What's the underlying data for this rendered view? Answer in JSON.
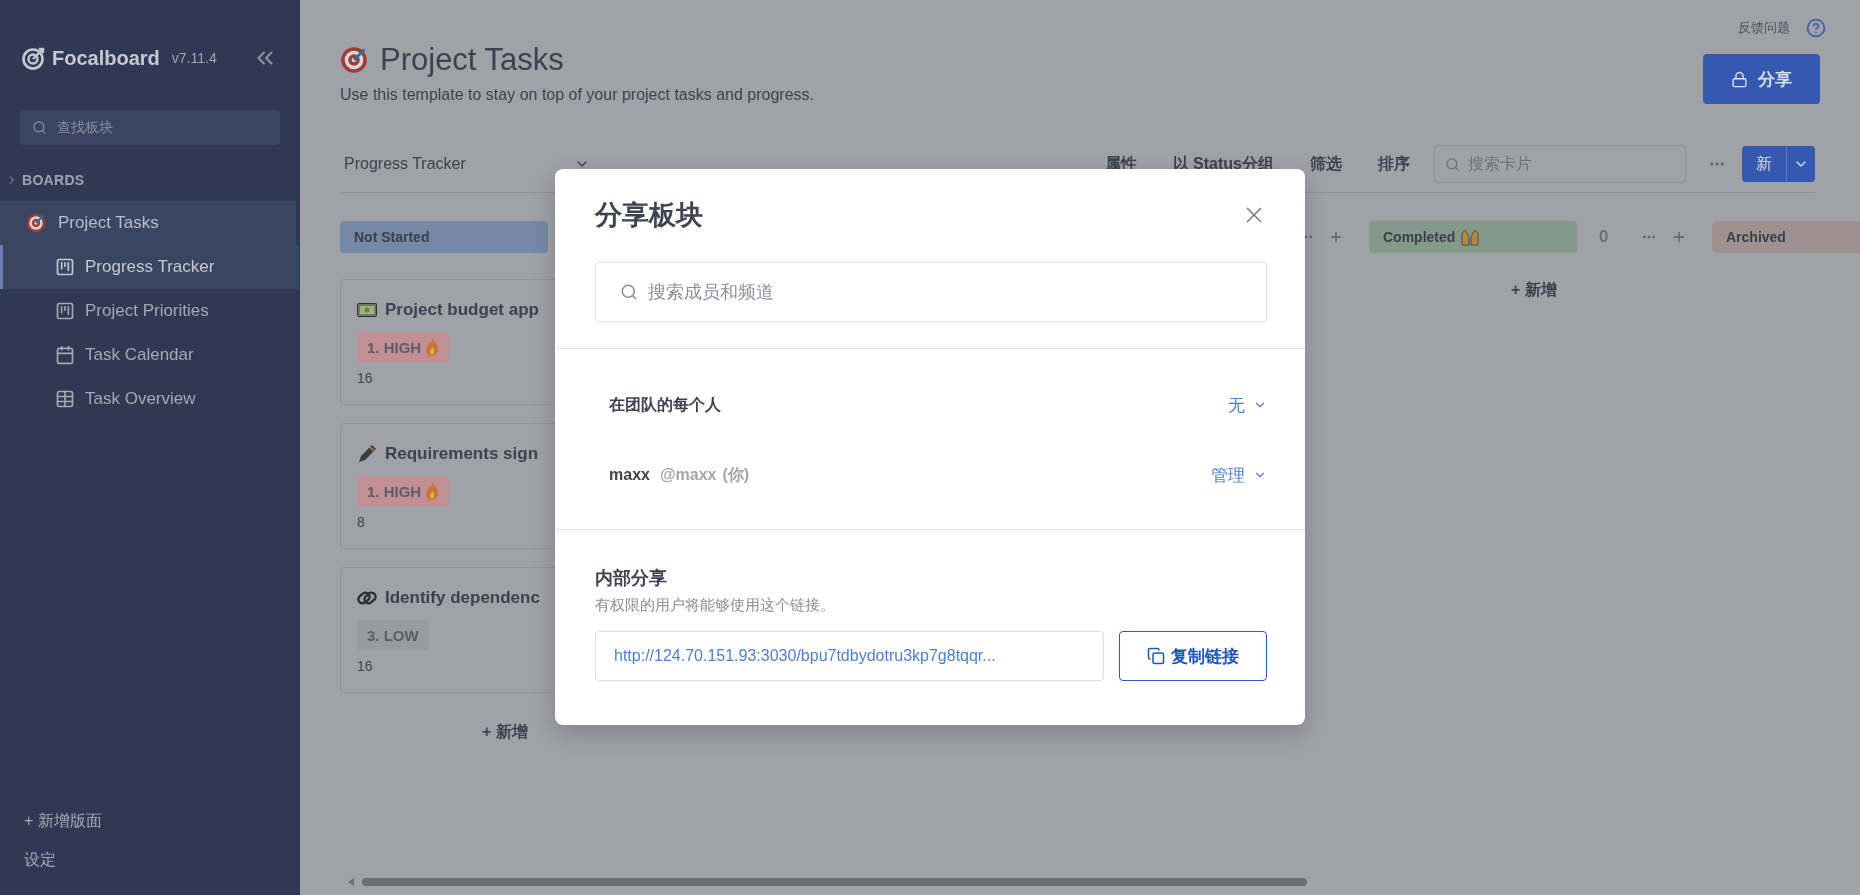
{
  "sidebar": {
    "app_name": "Focalboard",
    "version": "v7.11.4",
    "search": {
      "placeholder": "查找板块"
    },
    "section_label": "BOARDS",
    "boards": [
      {
        "title": "Project Tasks",
        "children": [
          {
            "title": "Progress Tracker",
            "kind": "board",
            "selected": true
          },
          {
            "title": "Project Priorities",
            "kind": "board",
            "selected": false
          },
          {
            "title": "Task Calendar",
            "kind": "calendar",
            "selected": false
          },
          {
            "title": "Task Overview",
            "kind": "table",
            "selected": false
          }
        ]
      }
    ],
    "add_board": "+ 新增版面",
    "settings": "设定"
  },
  "header": {
    "feedback": "反馈问题",
    "title": "Project Tasks",
    "description": "Use this template to stay on top of your project tasks and progress.",
    "share_button": "分享"
  },
  "toolbar": {
    "view": "Progress Tracker",
    "actions": [
      "属性",
      "以 Status分组",
      "筛选",
      "排序"
    ],
    "search": {
      "placeholder": "搜索卡片"
    },
    "new_button": "新"
  },
  "board": {
    "columns": [
      {
        "kind": "full",
        "title": "Not Started",
        "color": "#7589a7",
        "add": "+ 新增",
        "cards": [
          {
            "title": "Project budget app",
            "priority": {
              "label": "1. HIGH",
              "kind": "high",
              "color": "#c18f94"
            },
            "estimate": "16"
          },
          {
            "title": "Requirements sign",
            "priority": {
              "label": "1. HIGH",
              "kind": "high",
              "color": "#c18f94"
            },
            "estimate": "8"
          },
          {
            "title": "Identify dependenc",
            "priority": {
              "label": "3. LOW",
              "kind": "low",
              "color": "#999ba1"
            },
            "estimate": "16"
          }
        ]
      },
      {
        "kind": "actions_only"
      },
      {
        "kind": "full",
        "title": "Completed",
        "color": "#84998a",
        "count": "0",
        "add": "+ 新增"
      },
      {
        "kind": "full",
        "title": "Archived",
        "color": "#9d928f"
      }
    ]
  },
  "dialog": {
    "title": "分享板块",
    "search": {
      "placeholder": "搜索成员和频道"
    },
    "members": [
      {
        "kind": "team",
        "name": "在团队的每个人",
        "role": "无"
      },
      {
        "kind": "user",
        "name": "maxx",
        "handle": "@maxx",
        "note": "(你)",
        "role": "管理"
      }
    ],
    "internal": {
      "title": "内部分享",
      "description": "有权限的用户将能够使用这个链接。",
      "link": "http://124.70.151.93:3030/bpu7tdbydotru3kp7g8tqqr...",
      "copy_button": "复制链接"
    }
  }
}
